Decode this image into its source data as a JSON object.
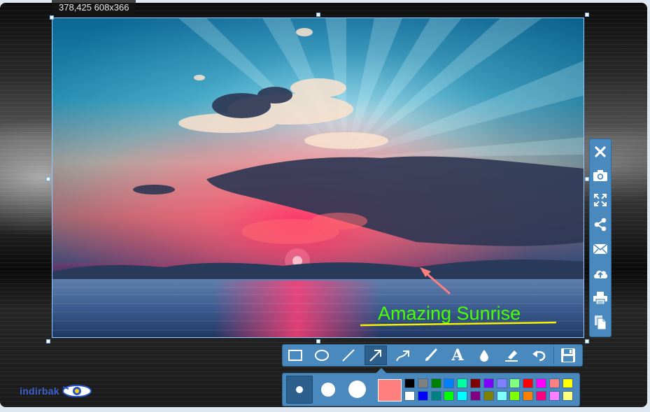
{
  "selection": {
    "coords_label": "378,425 608x366"
  },
  "annotation": {
    "text": "Amazing Sunrise",
    "text_color": "#4bff00",
    "underline_color": "#f6f100",
    "arrow_color": "#ff7f7f"
  },
  "side_toolbar": {
    "items": [
      {
        "name": "close-icon",
        "action": "close"
      },
      {
        "name": "camera-icon",
        "action": "capture"
      },
      {
        "name": "fullscreen-icon",
        "action": "fullscreen"
      },
      {
        "name": "share-icon",
        "action": "share"
      },
      {
        "name": "mail-icon",
        "action": "email"
      },
      {
        "name": "cloud-upload-icon",
        "action": "upload"
      },
      {
        "name": "print-icon",
        "action": "print"
      },
      {
        "name": "copy-icon",
        "action": "copy"
      }
    ]
  },
  "draw_toolbar": {
    "tools": [
      "rectangle-tool",
      "ellipse-tool",
      "line-tool",
      "arrow-tool",
      "curved-arrow-tool",
      "brush-tool",
      "text-tool",
      "blur-tool",
      "highlighter-tool",
      "undo-tool",
      "save-tool"
    ],
    "active_tool": "arrow-tool",
    "text_tool_glyph": "A"
  },
  "options": {
    "sizes": [
      "small",
      "medium",
      "large"
    ],
    "selected_size": "small",
    "current_color": "#ff7f7f",
    "palette_row1": [
      "#000000",
      "#808080",
      "#008000",
      "#0080ff",
      "#00ffa0",
      "#800000",
      "#8000ff",
      "#8080ff",
      "#80ff80",
      "#ff0000",
      "#ff00ff",
      "#ff8080",
      "#ffff00"
    ],
    "palette_row2": [
      "#ffffff",
      "#0000ff",
      "#008080",
      "#00ff00",
      "#00ffff",
      "#800080",
      "#808000",
      "#80ffff",
      "#80ff00",
      "#ff8000",
      "#ff0080",
      "#ff80ff",
      "#ffff80"
    ]
  },
  "brand": {
    "logo_text": "indirbak"
  },
  "colors": {
    "toolbar_bg": "#4a89be",
    "toolbar_active": "#2d5f8c",
    "selection_border": "#8ec6ff"
  }
}
